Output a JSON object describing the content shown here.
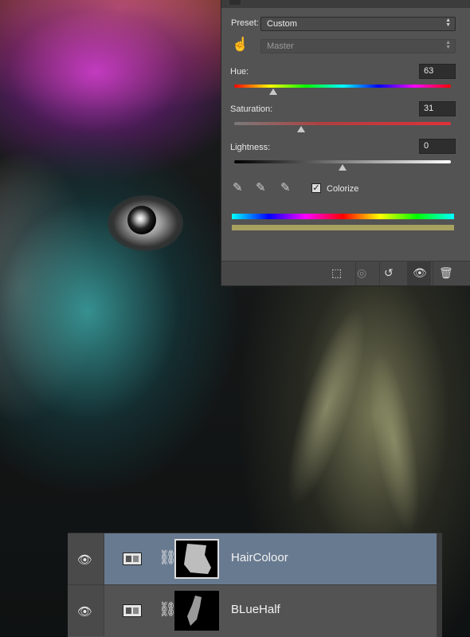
{
  "hue_sat_panel": {
    "preset_label": "Preset:",
    "preset_value": "Custom",
    "channel_value": "Master",
    "hue": {
      "label": "Hue:",
      "value": "63",
      "position": 0.18
    },
    "saturation": {
      "label": "Saturation:",
      "value": "31",
      "position": 0.31
    },
    "lightness": {
      "label": "Lightness:",
      "value": "0",
      "position": 0.5
    },
    "colorize_label": "Colorize",
    "colorize_checked": true,
    "result_color": "#a7a260",
    "icons": [
      "hand-adjust-icon",
      "eyedropper-icon",
      "eyedropper-plus-icon",
      "eyedropper-minus-icon",
      "clip-to-layer-icon",
      "view-previous-icon",
      "reset-icon",
      "visibility-eye-icon",
      "trash-icon"
    ]
  },
  "layers": [
    {
      "name": "HairColoor",
      "selected": true,
      "icon": "hue-saturation-adjustment-icon"
    },
    {
      "name": "BLueHalf",
      "selected": false,
      "icon": "hue-saturation-adjustment-icon"
    }
  ],
  "colors": {
    "panel_bg": "#535353",
    "selected_layer_bg": "#687a90",
    "saturation_track": "#e0303a",
    "colorize_bar": "#a7a260"
  }
}
